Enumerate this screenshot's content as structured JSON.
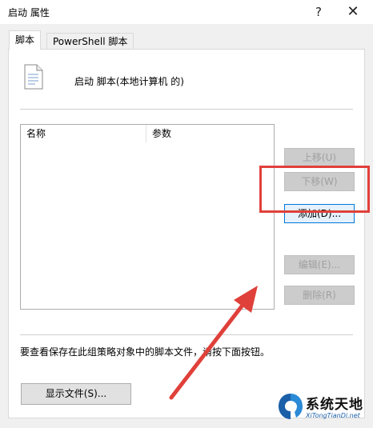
{
  "window": {
    "title": "启动 属性",
    "help_label": "?",
    "close_label": "✕"
  },
  "tabs": [
    {
      "label": "脚本",
      "active": true
    },
    {
      "label": "PowerShell 脚本",
      "active": false
    }
  ],
  "header": {
    "label": "启动 脚本(本地计算机 的)",
    "icon": "script-file-icon"
  },
  "list": {
    "columns": [
      "名称",
      "参数"
    ],
    "rows": []
  },
  "buttons": {
    "up": "上移(U)",
    "down": "下移(W)",
    "add": "添加(D)...",
    "edit": "编辑(E)...",
    "delete": "删除(R)",
    "show_files": "显示文件(S)..."
  },
  "hint": "要查看保存在此组策略对象中的脚本文件，请按下面按钮。",
  "annotation": {
    "highlight_color": "#e0403a",
    "arrow_color": "#e0403a"
  },
  "watermark": {
    "title": "系统天地",
    "subtitle": "XiTongTianDi.net"
  }
}
